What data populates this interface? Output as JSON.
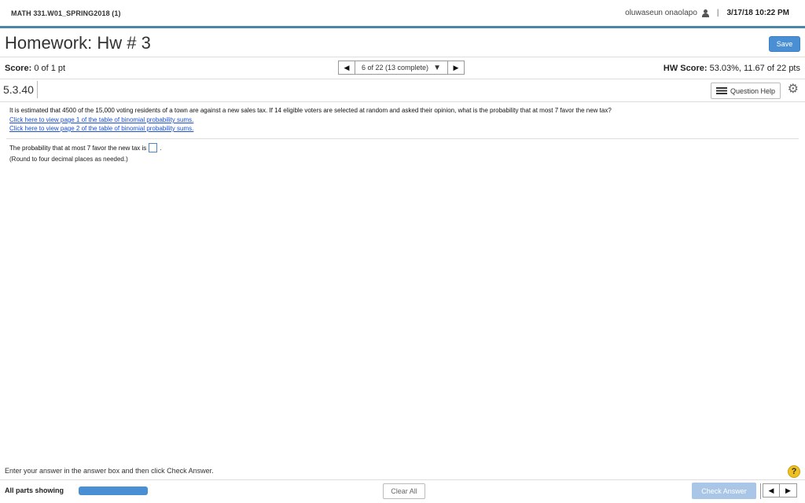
{
  "topbar": {
    "course": "MATH 331.W01_SPRING2018 (1)",
    "username": "oluwaseun onaolapo",
    "separator": "|",
    "datetime": "3/17/18 10:22 PM"
  },
  "header": {
    "title": "Homework: Hw # 3",
    "save_label": "Save"
  },
  "score_row": {
    "score_label": "Score:",
    "score_value": "0 of 1 pt",
    "nav_text": "6 of 22 (13 complete)",
    "hw_score_label": "HW Score:",
    "hw_score_value": "53.03%, 11.67 of 22 pts"
  },
  "question_header": {
    "id": "5.3.40",
    "help_label": "Question Help"
  },
  "question": {
    "text": "It is estimated that 4500 of the 15,000 voting residents of a town are against a new sales tax. If 14 eligible voters are selected at random and asked their opinion, what is the probability that at most 7 favor the new tax?",
    "link1": "Click here to view page 1 of the table of binomial probability sums.",
    "link2": "Click here to view page 2 of the table of binomial probability sums.",
    "answer_prefix": "The probability that at most 7 favor the new tax is",
    "answer_value": "",
    "answer_suffix": ".",
    "round_note": "(Round to four decimal places as needed.)"
  },
  "footer": {
    "instructions": "Enter your answer in the answer box and then click Check Answer.",
    "help_symbol": "?",
    "parts_label": "All parts showing",
    "progress": 1.0,
    "clear_label": "Clear All",
    "check_label": "Check Answer"
  },
  "colors": {
    "accent": "#4a8fd4",
    "link": "#1a4fd6",
    "check_disabled": "#a9c6e6",
    "help": "#f0c020"
  },
  "icons": [
    "person-icon",
    "left-arrow-icon",
    "right-arrow-icon",
    "dropdown-arrow-icon",
    "list-icon",
    "gear-icon",
    "help-icon"
  ]
}
